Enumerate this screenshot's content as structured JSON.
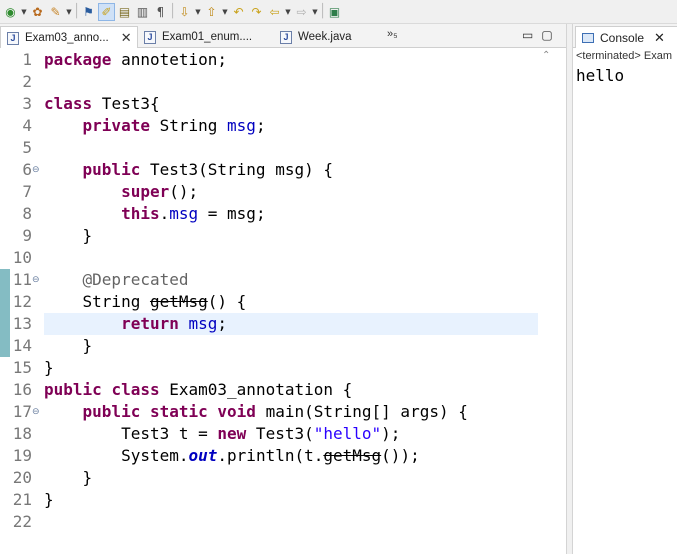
{
  "toolbar": {
    "buttons": [
      "run-icon",
      "debug-icon",
      "build-icon",
      "toggle-breakpoint-icon",
      "mark-occurrences-icon",
      "toggle-block-selection-icon",
      "word-wrap-icon",
      "show-whitespace-icon",
      "next-annotation-icon",
      "previous-annotation-icon",
      "last-edit-location-icon",
      "back-icon",
      "forward-icon",
      "new-window-icon"
    ]
  },
  "editor": {
    "tabs": [
      {
        "label": "Exam03_anno...",
        "active": true,
        "close": "✕"
      },
      {
        "label": "Exam01_enum....",
        "active": false
      },
      {
        "label": "Week.java",
        "active": false
      }
    ],
    "overflow": "»₅",
    "lines": [
      {
        "n": "1"
      },
      {
        "n": "2"
      },
      {
        "n": "3"
      },
      {
        "n": "4"
      },
      {
        "n": "5"
      },
      {
        "n": "6"
      },
      {
        "n": "7"
      },
      {
        "n": "8"
      },
      {
        "n": "9"
      },
      {
        "n": "10"
      },
      {
        "n": "11"
      },
      {
        "n": "12"
      },
      {
        "n": "13"
      },
      {
        "n": "14"
      },
      {
        "n": "15"
      },
      {
        "n": "16"
      },
      {
        "n": "17"
      },
      {
        "n": "18"
      },
      {
        "n": "19"
      },
      {
        "n": "20"
      },
      {
        "n": "21"
      },
      {
        "n": "22"
      }
    ],
    "code": {
      "l1": [
        "package",
        " annotetion;"
      ],
      "l3": [
        "class",
        " Test3{"
      ],
      "l4": [
        "private",
        " String ",
        "msg",
        ";"
      ],
      "l6": [
        "public",
        " Test3(String msg) {"
      ],
      "l7": [
        "super",
        "();"
      ],
      "l8": [
        "this",
        ".",
        "msg",
        " = msg;"
      ],
      "l9": "}",
      "l11": "@Deprecated",
      "l12": [
        "String ",
        "getMsg",
        "() {"
      ],
      "l13": [
        "return",
        " ",
        "msg",
        ";"
      ],
      "l14": "}",
      "l15": "}",
      "l16": [
        "public",
        " ",
        "class",
        " Exam03_annotation {"
      ],
      "l17": [
        "public",
        " ",
        "static",
        " ",
        "void",
        " main(String[] args) {"
      ],
      "l18": [
        "Test3 t = ",
        "new",
        " Test3(",
        "\"hello\"",
        ");"
      ],
      "l19": [
        "System.",
        "out",
        ".println(t.",
        "getMsg",
        "());"
      ],
      "l20": "}",
      "l21": "}"
    }
  },
  "console": {
    "tab_label": "Console",
    "close": "✕",
    "status": "<terminated> Exam",
    "output": "hello"
  }
}
